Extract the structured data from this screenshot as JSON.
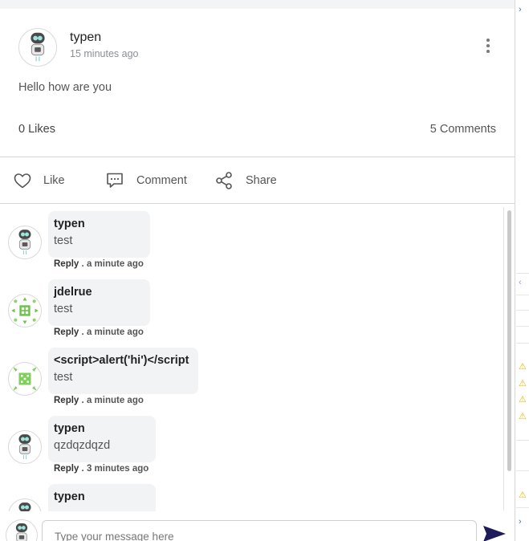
{
  "post": {
    "author": "typen",
    "time": "15 minutes ago",
    "body": "Hello how are you",
    "likes": "0 Likes",
    "comments_count": "5 Comments"
  },
  "actions": {
    "like": "Like",
    "comment": "Comment",
    "share": "Share"
  },
  "comments": [
    {
      "author": "typen",
      "text": "test",
      "reply": "Reply",
      "sep": ".",
      "time": "a minute ago",
      "avatar": "robot-avatar"
    },
    {
      "author": "jdelrue",
      "text": "test",
      "reply": "Reply",
      "sep": ".",
      "time": "a minute ago",
      "avatar": "green-pattern-avatar"
    },
    {
      "author": "<script>alert('hi')</script",
      "text": "test",
      "reply": "Reply",
      "sep": ".",
      "time": "a minute ago",
      "avatar": "green-pattern-avatar"
    },
    {
      "author": "typen",
      "text": "qzdqzdqzd",
      "reply": "Reply",
      "sep": ".",
      "time": "3 minutes ago",
      "avatar": "robot-avatar"
    },
    {
      "author": "typen",
      "text": "",
      "avatar": "robot-avatar"
    }
  ],
  "composer": {
    "placeholder": "Type your message here"
  },
  "colors": {
    "send": "#1e1b5a",
    "warning": "#e6b800",
    "side_accent": "#4a67d6"
  }
}
